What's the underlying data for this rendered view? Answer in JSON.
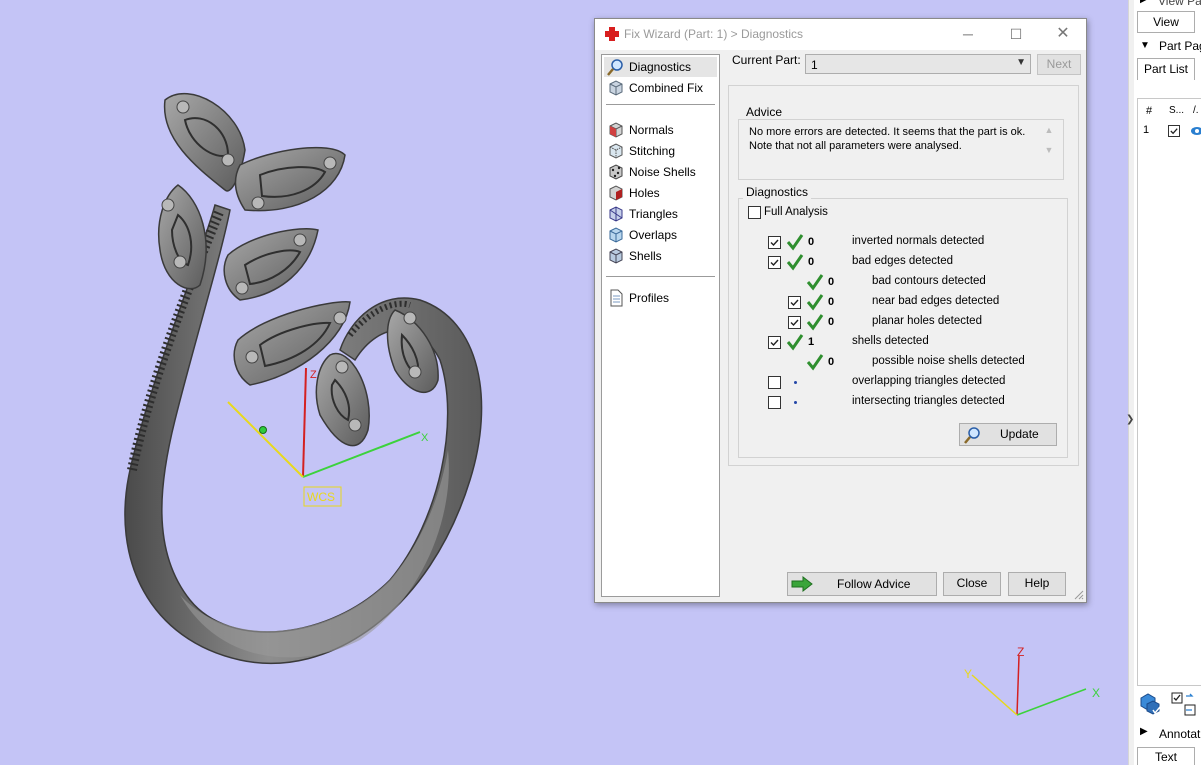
{
  "dialog": {
    "title": "Fix Wizard (Part: 1) > Diagnostics",
    "current_part_label": "Current Part:",
    "current_part_value": "1",
    "next_label": "Next",
    "advice_title": "Advice",
    "advice_text": "No more errors are detected. It seems that the part is ok. Note that not all parameters were analysed.",
    "diagnostics_title": "Diagnostics",
    "full_analysis_label": "Full Analysis",
    "update_label": "Update",
    "follow_advice_label": "Follow Advice",
    "close_label": "Close",
    "help_label": "Help",
    "nav": {
      "diagnostics": "Diagnostics",
      "combined_fix": "Combined Fix",
      "normals": "Normals",
      "stitching": "Stitching",
      "noise_shells": "Noise Shells",
      "holes": "Holes",
      "triangles": "Triangles",
      "overlaps": "Overlaps",
      "shells": "Shells",
      "profiles": "Profiles"
    },
    "rows": [
      {
        "count": "0",
        "text": "inverted normals detected"
      },
      {
        "count": "0",
        "text": "bad edges detected"
      },
      {
        "count": "0",
        "text": "bad contours detected"
      },
      {
        "count": "0",
        "text": "near bad edges detected"
      },
      {
        "count": "0",
        "text": "planar holes detected"
      },
      {
        "count": "1",
        "text": "shells detected"
      },
      {
        "count": "0",
        "text": "possible noise shells detected"
      },
      {
        "count": "",
        "text": "overlapping triangles detected"
      },
      {
        "count": "",
        "text": "intersecting triangles detected"
      }
    ]
  },
  "viewport": {
    "wcs_label": "WCS",
    "axis_x": "X",
    "axis_y": "Y",
    "axis_z": "Z"
  },
  "right_panel": {
    "view_pages_title": "View Pa",
    "view_tab": "View",
    "part_pages_title": "Part Pag",
    "part_list_tab": "Part List",
    "col_hash": "#",
    "col_s": "S...",
    "col_v": "/.",
    "row1_num": "1",
    "annotations_title": "Annotati",
    "text_tab": "Text"
  },
  "colors": {
    "viewport_bg": "#c4c4f6",
    "tick_green": "#2f8f2f",
    "accent_red": "#e02020"
  }
}
